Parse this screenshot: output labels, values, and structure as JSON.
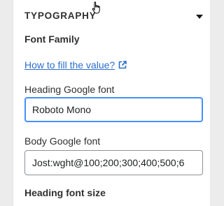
{
  "section": {
    "title": "TYPOGRAPHY"
  },
  "font_family": {
    "heading": "Font Family",
    "help_link": "How to fill the value?"
  },
  "heading_font": {
    "label": "Heading Google font",
    "value": "Roboto Mono"
  },
  "body_font": {
    "label": "Body Google font",
    "value": "Jost:wght@100;200;300;400;500;6"
  },
  "heading_size": {
    "label": "Heading font size"
  },
  "colors": {
    "accent": "#458fff",
    "link": "#2c6ecb",
    "text": "#303030"
  },
  "icons": [
    "chevron-down-icon",
    "external-link-icon",
    "hand-pointer-icon"
  ]
}
